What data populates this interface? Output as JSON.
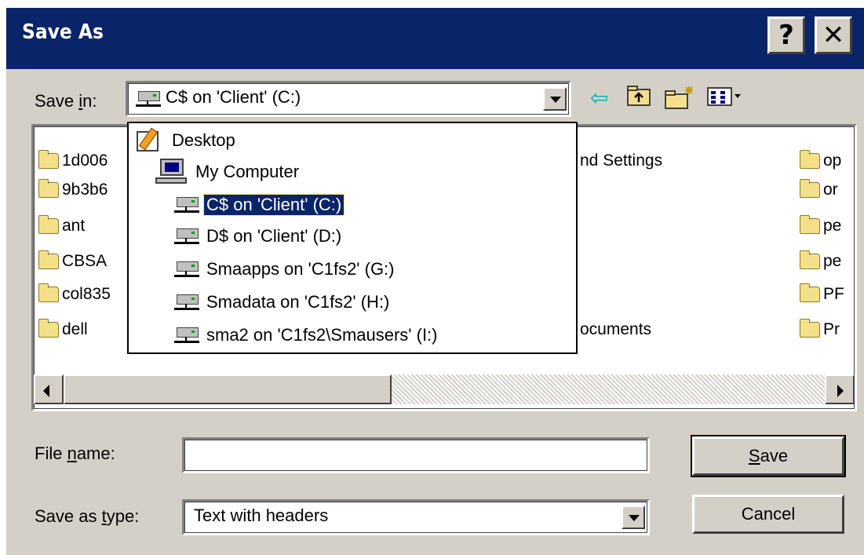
{
  "window": {
    "title": "Save As",
    "help_button": "?",
    "close_button": "✕"
  },
  "save_in": {
    "label_pre": "Save ",
    "label_u": "i",
    "label_post": "n:",
    "value": "C$ on 'Client' (C:)"
  },
  "toolbar": {
    "back_icon": "back-arrow-icon",
    "up_icon": "up-one-level-icon",
    "new_folder_icon": "new-folder-icon",
    "view_menu_icon": "view-menu-icon"
  },
  "files": {
    "col1": [
      "1d006",
      "9b3b6",
      "ant",
      "CBSA",
      "col835",
      "dell"
    ],
    "col2": [
      "nd Settings",
      "ocuments"
    ],
    "col3": [
      "op",
      "or",
      "pe",
      "pe",
      "PF",
      "Pr"
    ]
  },
  "dropdown": {
    "items": [
      {
        "label": "Desktop",
        "icon": "desktop-icon"
      },
      {
        "label": "My Computer",
        "icon": "my-computer-icon"
      },
      {
        "label": "C$ on 'Client' (C:)",
        "icon": "network-drive-icon",
        "selected": true
      },
      {
        "label": "D$ on 'Client' (D:)",
        "icon": "network-drive-icon"
      },
      {
        "label": "Smaapps on 'C1fs2' (G:)",
        "icon": "network-drive-icon"
      },
      {
        "label": "Smadata on 'C1fs2' (H:)",
        "icon": "network-drive-icon"
      },
      {
        "label": "sma2 on 'C1fs2\\Smausers' (I:)",
        "icon": "network-drive-icon"
      }
    ]
  },
  "file_name": {
    "label_pre": "File ",
    "label_u": "n",
    "label_post": "ame:",
    "value": ""
  },
  "save_as_type": {
    "label_pre": "Save as ",
    "label_u": "t",
    "label_post": "ype:",
    "value": "Text with headers"
  },
  "buttons": {
    "save_u": "S",
    "save_rest": "ave",
    "cancel": "Cancel"
  },
  "colors": {
    "titlebar": "#0a246a",
    "face": "#d4d0c8",
    "selection": "#0a246a"
  }
}
